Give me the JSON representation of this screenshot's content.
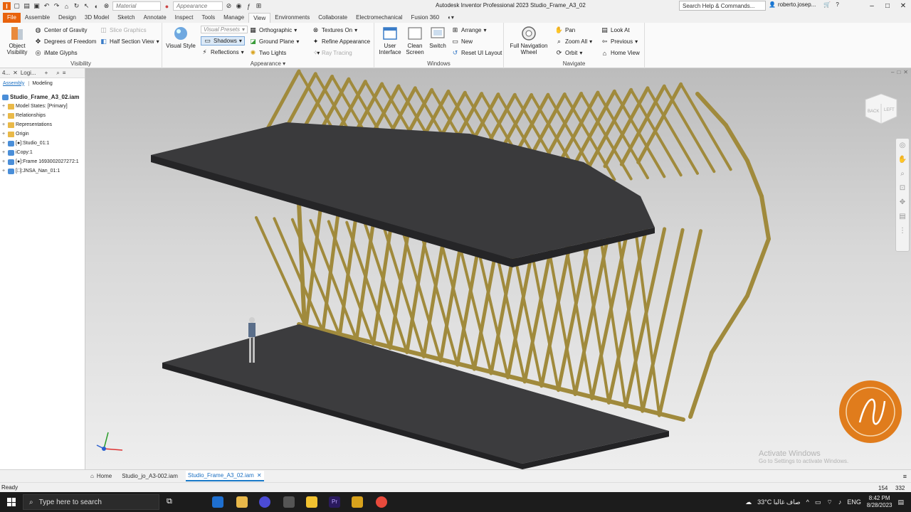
{
  "window": {
    "title": "Autodesk Inventor Professional 2023   Studio_Frame_A3_02",
    "search_placeholder": "Search Help & Commands...",
    "user": "roberto.josep...",
    "material_combo": "Material",
    "appearance_combo": "Appearance"
  },
  "tabs": [
    "File",
    "Assemble",
    "Design",
    "3D Model",
    "Sketch",
    "Annotate",
    "Inspect",
    "Tools",
    "Manage",
    "View",
    "Environments",
    "Collaborate",
    "Electromechanical",
    "Fusion 360"
  ],
  "active_tab": "View",
  "ribbon": {
    "visibility": {
      "label": "Visibility",
      "object_visibility": "Object Visibility",
      "center_of_gravity": "Center of Gravity",
      "degrees_of_freedom": "Degrees of Freedom",
      "imate_glyphs": "iMate Glyphs",
      "slice_graphics": "Slice Graphics",
      "half_section_view": "Half Section View"
    },
    "appearance": {
      "label": "Appearance",
      "visual_style": "Visual Style",
      "visual_presets": "Visual Presets",
      "shadows": "Shadows",
      "reflections": "Reflections",
      "orthographic": "Orthographic",
      "ground_plane": "Ground Plane",
      "two_lights": "Two Lights",
      "textures_on": "Textures On",
      "refine_appearance": "Refine Appearance",
      "ray_tracing": "Ray Tracing"
    },
    "windows": {
      "label": "Windows",
      "user_interface": "User Interface",
      "clean_screen": "Clean Screen",
      "switch": "Switch",
      "arrange": "Arrange",
      "new": "New",
      "reset_ui_layout": "Reset UI Layout"
    },
    "navigate": {
      "label": "Navigate",
      "full_navigation_wheel": "Full Navigation Wheel",
      "pan": "Pan",
      "zoom_all": "Zoom All",
      "orbit": "Orbit",
      "look_at": "Look At",
      "previous": "Previous",
      "home_view": "Home View"
    }
  },
  "browser": {
    "tab1": "4...",
    "tab2": "Logi...",
    "assembly": "Assembly",
    "modeling": "Modeling",
    "root": "Studio_Frame_A3_02.iam",
    "nodes": [
      "Model States: [Primary]",
      "Relationships",
      "Representations",
      "Origin",
      "[●]:Studio_01:1",
      "iCopy:1",
      "[●]:Frame 1693002027272:1",
      "[□]:JNSA_Nan_01:1"
    ]
  },
  "viewcube": {
    "back": "BACK",
    "left": "LEFT"
  },
  "doc_tabs": {
    "home": "Home",
    "tab1": "Studio_jo_A3-002.iam",
    "tab2": "Studio_Frame_A3_02.iam"
  },
  "status": {
    "text": "Ready",
    "v1": "154",
    "v2": "332"
  },
  "watermark": {
    "line1": "Activate Windows",
    "line2": "Go to Settings to activate Windows."
  },
  "taskbar": {
    "search": "Type here to search",
    "weather": "33°C صاف غالبا",
    "lang": "ENG",
    "time": "8:42 PM",
    "date": "8/28/2023"
  },
  "colors": {
    "file_tab": "#e8620c",
    "frame_gold": "#a08a3c",
    "platform": "#3c3c3e"
  }
}
